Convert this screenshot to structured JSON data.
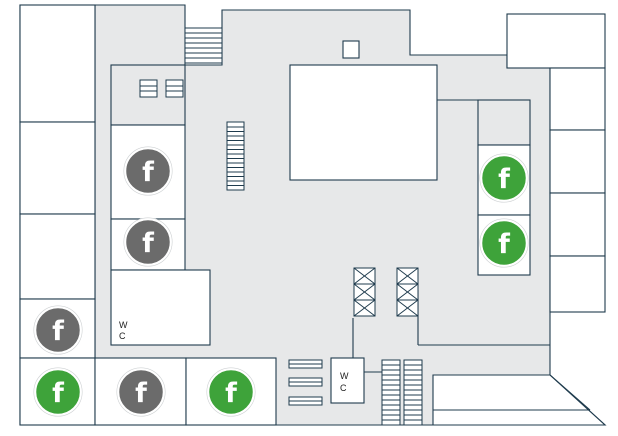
{
  "map": {
    "colors": {
      "corridor": "#e7e8e9",
      "wall": "#1f3b4d",
      "unit": "#ffffff",
      "badge_available": "#3ea33a",
      "badge_unavailable": "#6b6b6b",
      "badge_ring": "#ffffff"
    },
    "badge_glyph": "f",
    "badge_icon": "facility-f-icon",
    "toilets": [
      {
        "line1": "W",
        "line2": "C"
      },
      {
        "line1": "W",
        "line2": "C"
      }
    ],
    "badges": [
      {
        "status": "unavailable"
      },
      {
        "status": "unavailable"
      },
      {
        "status": "unavailable"
      },
      {
        "status": "available"
      },
      {
        "status": "unavailable"
      },
      {
        "status": "available"
      },
      {
        "status": "available"
      },
      {
        "status": "available"
      }
    ]
  }
}
